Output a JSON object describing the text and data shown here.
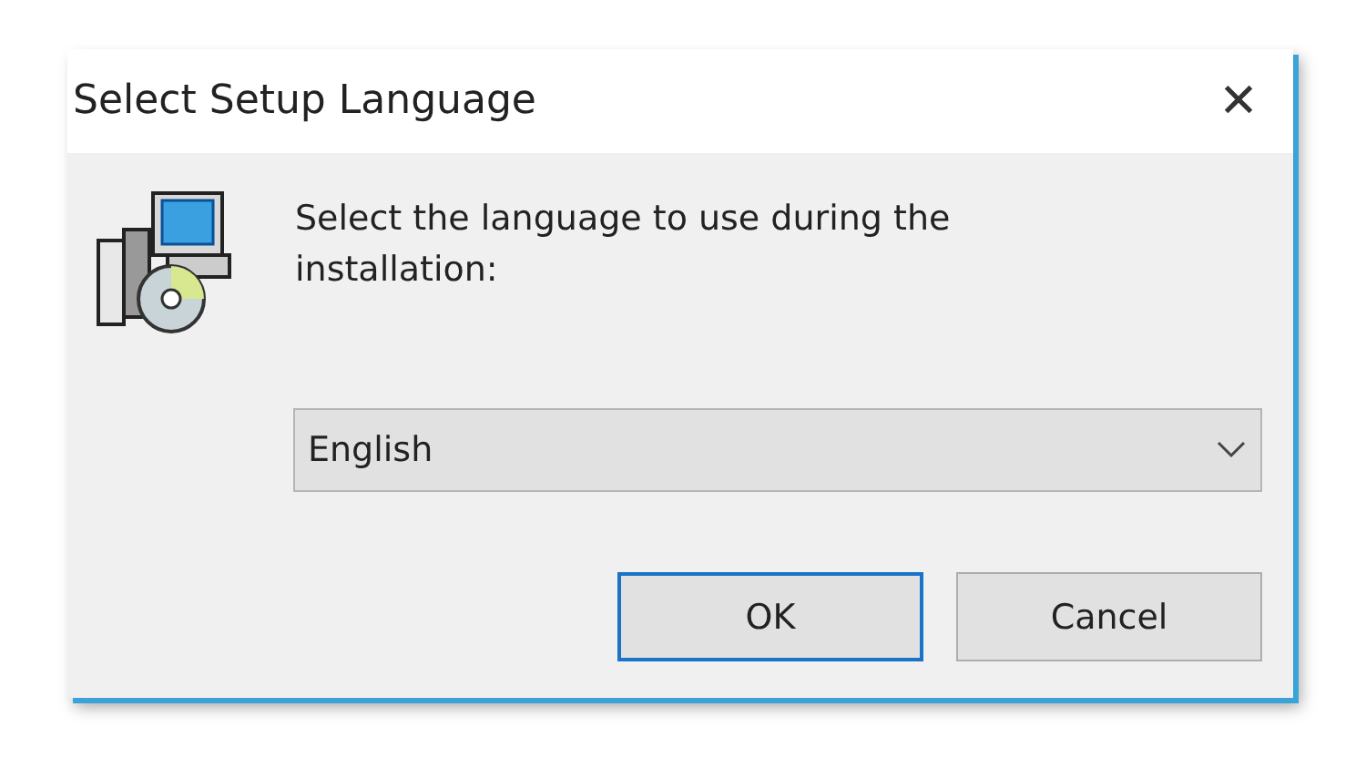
{
  "window": {
    "title": "Select Setup Language",
    "close": "✕"
  },
  "prompt": "Select the language to use during the installation:",
  "language_select": {
    "value": "English"
  },
  "buttons": [
    {
      "label": "OK",
      "default": true
    },
    {
      "label": "Cancel",
      "default": false
    }
  ]
}
